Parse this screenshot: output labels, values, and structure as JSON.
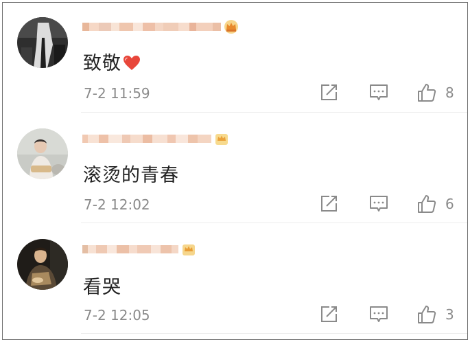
{
  "comments": [
    {
      "text": "致敬",
      "time": "7-2 11:59",
      "likes": "8",
      "has_heart": true,
      "avatar_icon": "avatar-dark-figure"
    },
    {
      "text": "滚烫的青春",
      "time": "7-2 12:02",
      "likes": "6",
      "has_heart": false,
      "avatar_icon": "avatar-child-photo"
    },
    {
      "text": "看哭",
      "time": "7-2 12:05",
      "likes": "3",
      "has_heart": false,
      "avatar_icon": "avatar-portrait-painting"
    }
  ],
  "icons": {
    "repost": "repost-icon",
    "comment": "comment-icon",
    "like": "thumbs-up-icon",
    "badge": "vip-crown-icon",
    "heart": "heart-emoji-icon"
  },
  "colors": {
    "text": "#222222",
    "meta": "#8a8a8a",
    "heart": "#e8463a",
    "crown": "#f2b53a",
    "divider": "#ececec"
  }
}
